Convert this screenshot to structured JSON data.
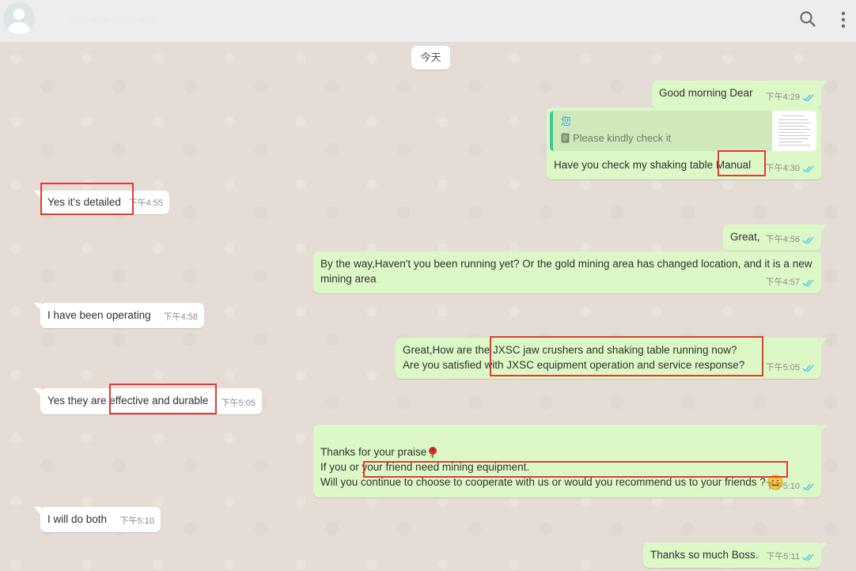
{
  "header": {
    "contact_name": "···· ·· ·· ······ ····",
    "search_icon": "search-icon",
    "menu_icon": "more-vertical-icon"
  },
  "date_chip": "今天",
  "messages": [
    {
      "direction": "out",
      "text": "Good morning Dear",
      "time": "下午4:29",
      "status": "read"
    },
    {
      "direction": "out",
      "quote": {
        "author": "您",
        "text": "Please kindly check it",
        "icon": "document-icon"
      },
      "text": "Have you check my shaking table Manual",
      "time": "下午4:30",
      "status": "read"
    },
    {
      "direction": "in",
      "text": "Yes it's detailed",
      "time": "下午4:55"
    },
    {
      "direction": "out",
      "text": "Great,",
      "time": "下午4:56",
      "status": "read"
    },
    {
      "direction": "out",
      "text": "By the way,Haven't you been running yet? Or the gold mining area has changed location, and it is a new mining area",
      "time": "下午4:57",
      "status": "read"
    },
    {
      "direction": "in",
      "text": "I have been operating",
      "time": "下午4:58"
    },
    {
      "direction": "out",
      "text": "Great,How are the JXSC jaw crushers and shaking table running now?\nAre you satisfied with JXSC equipment operation and  service response?",
      "time": "下午5:05",
      "status": "read"
    },
    {
      "direction": "in",
      "text": "Yes they are effective and durable",
      "time": "下午5:05"
    },
    {
      "direction": "out",
      "text_line1": "Thanks for your praise",
      "text_line2": "If you or your friend need mining equipment.",
      "text_line3": "Will you continue to choose to cooperate with us or would you recommend us to your friends ?",
      "emoji1": "rose-emoji",
      "emoji2": "smiling-face-emoji",
      "time": "下午5:10",
      "status": "read"
    },
    {
      "direction": "in",
      "text": "I will do both",
      "time": "下午5:10"
    },
    {
      "direction": "out",
      "text": "Thanks so much Boss.",
      "time": "下午5:11",
      "status": "read"
    }
  ],
  "colors": {
    "outgoing_bubble": "#dcf8c6",
    "incoming_bubble": "#ffffff",
    "read_ticks": "#4fc3f7",
    "highlight_box": "#e53935",
    "chat_background": "#e5ddd5"
  }
}
